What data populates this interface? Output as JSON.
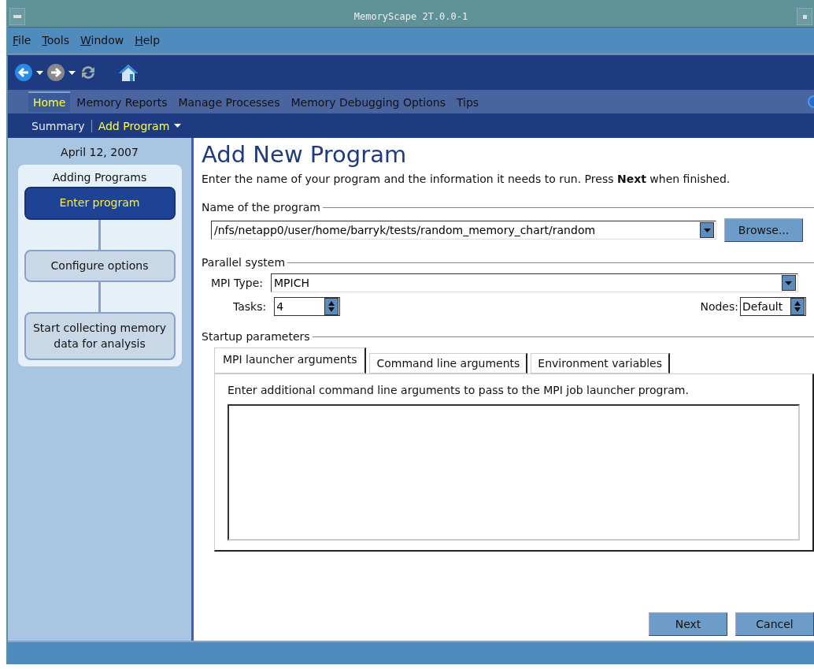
{
  "window": {
    "title": "MemoryScape 2T.0.0-1"
  },
  "menu": [
    "File",
    "Tools",
    "Window",
    "Help"
  ],
  "nav_tabs": [
    {
      "label": "Home",
      "selected": true
    },
    {
      "label": "Memory Reports",
      "selected": false
    },
    {
      "label": "Manage Processes",
      "selected": false
    },
    {
      "label": "Memory Debugging Options",
      "selected": false
    },
    {
      "label": "Tips",
      "selected": false
    }
  ],
  "sub_nav": [
    {
      "label": "Summary",
      "selected": false,
      "dropdown": false
    },
    {
      "label": "Add Program",
      "selected": true,
      "dropdown": true
    }
  ],
  "sidebar": {
    "date": "April 12, 2007",
    "title": "Adding Programs",
    "steps": [
      {
        "label": "Enter program",
        "selected": true
      },
      {
        "label": "Configure options",
        "selected": false
      },
      {
        "label": "Start collecting memory data for analysis",
        "selected": false
      }
    ]
  },
  "heading": "Add New Program",
  "intro": "Enter the name of your program and the information it needs to run. Press **Next** when finished.",
  "program": {
    "legend": "Name of the program",
    "value": "/nfs/netapp0/user/home/barryk/tests/random_memory_chart/random",
    "browse": "Browse..."
  },
  "parallel": {
    "legend": "Parallel system",
    "mpi_label": "MPI Type:",
    "mpi_value": "MPICH",
    "tasks_label": "Tasks:",
    "tasks_value": "4",
    "nodes_label": "Nodes:",
    "nodes_value": "Default"
  },
  "startup": {
    "legend": "Startup parameters",
    "tabs": [
      {
        "label": "MPI launcher arguments",
        "selected": true
      },
      {
        "label": "Command line arguments",
        "selected": false
      },
      {
        "label": "Environment variables",
        "selected": false
      }
    ],
    "hint": "Enter additional command line arguments to pass to the MPI job launcher program."
  },
  "buttons": [
    "Next",
    "Cancel"
  ]
}
